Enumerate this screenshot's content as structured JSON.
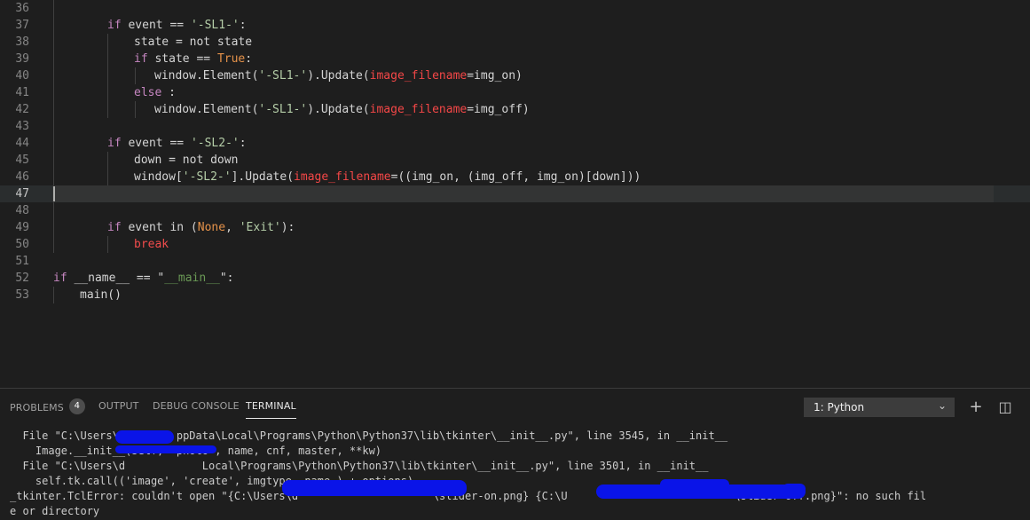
{
  "editor": {
    "current_line": 47,
    "lines": [
      {
        "n": "36"
      },
      {
        "n": "37",
        "segs": [
          [
            "kw",
            "if"
          ],
          [
            "",
            "event == "
          ],
          [
            "str",
            "'-SL1-'"
          ],
          [
            "",
            ":"
          ]
        ]
      },
      {
        "n": "38",
        "segs": [
          [
            "",
            "state = not state"
          ]
        ]
      },
      {
        "n": "39",
        "segs": [
          [
            "kw",
            "if"
          ],
          [
            "",
            "state == "
          ],
          [
            "cst",
            "True"
          ],
          [
            "",
            ":"
          ]
        ]
      },
      {
        "n": "40",
        "segs": [
          [
            "",
            "window.Element("
          ],
          [
            "str",
            "'-SL1-'"
          ],
          [
            "",
            ").Update("
          ],
          [
            "prm",
            "image_filename"
          ],
          [
            "",
            "=img_on)"
          ]
        ]
      },
      {
        "n": "41",
        "segs": [
          [
            "kw",
            "else"
          ],
          [
            "",
            ":"
          ]
        ]
      },
      {
        "n": "42",
        "segs": [
          [
            "",
            "window.Element("
          ],
          [
            "str",
            "'-SL1-'"
          ],
          [
            "",
            ").Update("
          ],
          [
            "prm",
            "image_filename"
          ],
          [
            "",
            "=img_off)"
          ]
        ]
      },
      {
        "n": "43"
      },
      {
        "n": "44",
        "segs": [
          [
            "kw",
            "if"
          ],
          [
            "",
            "event == "
          ],
          [
            "str",
            "'-SL2-'"
          ],
          [
            "",
            ":"
          ]
        ]
      },
      {
        "n": "45",
        "segs": [
          [
            "",
            "down = not down"
          ]
        ]
      },
      {
        "n": "46",
        "segs": [
          [
            "",
            "window["
          ],
          [
            "str",
            "'-SL2-'"
          ],
          [
            "",
            "].Update("
          ],
          [
            "prm",
            "image_filename"
          ],
          [
            "",
            "=((img_on, (img_off, img_on)[down]))"
          ]
        ]
      },
      {
        "n": "47"
      },
      {
        "n": "48"
      },
      {
        "n": "49",
        "segs": [
          [
            "kw",
            "if"
          ],
          [
            "",
            "event in ("
          ],
          [
            "cst",
            "None"
          ],
          [
            "",
            ", "
          ],
          [
            "str",
            "'Exit'"
          ],
          [
            "",
            "):"
          ]
        ]
      },
      {
        "n": "50",
        "segs": [
          [
            "pink",
            "break"
          ]
        ]
      },
      {
        "n": "51"
      },
      {
        "n": "52",
        "segs": [
          [
            "kw",
            "if"
          ],
          [
            "",
            "__name__ == "
          ],
          [
            "",
            "\""
          ],
          [
            "strg",
            "__main__"
          ],
          [
            "",
            "\":"
          ]
        ]
      },
      {
        "n": "53",
        "segs": [
          [
            "",
            "main()"
          ]
        ]
      }
    ]
  },
  "panel": {
    "tabs": [
      {
        "label": "PROBLEMS",
        "badge": "4"
      },
      {
        "label": "OUTPUT"
      },
      {
        "label": "DEBUG CONSOLE"
      },
      {
        "label": "TERMINAL",
        "active": true
      }
    ],
    "terminal_select": "1: Python",
    "add_label": "+",
    "split_label": "◫",
    "trash_label": "🗑"
  },
  "terminal": {
    "lines": [
      "  File \"C:\\Users\\d        ppData\\Local\\Programs\\Python\\Python37\\lib\\tkinter\\__init__.py\", line 3545, in __init__",
      "    Image.__init__(self, 'photo', name, cnf, master, **kw)",
      "  File \"C:\\Users\\d            Local\\Programs\\Python\\Python37\\lib\\tkinter\\__init__.py\", line 3501, in __init__",
      "    self.tk.call(('image', 'create', imgtype, name,) + options)",
      "_tkinter.TclError: couldn't open \"{C:\\Users\\d                     \\slider-on.png} {C:\\U                          \\slider-off.png}\": no such fil",
      "e or directory"
    ]
  }
}
